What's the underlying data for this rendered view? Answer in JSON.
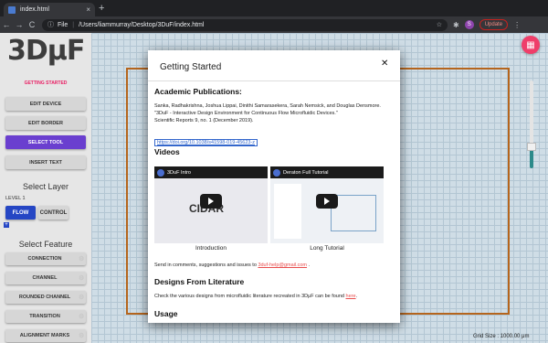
{
  "browser": {
    "tab_title": "index.html",
    "tab_close": "×",
    "new_tab": "+",
    "back": "←",
    "forward": "→",
    "reload": "C",
    "info_label": "File",
    "url": "/Users/liammurray/Desktop/3DuF/index.html",
    "star": "☆",
    "avatar": "S",
    "update_label": "Update",
    "menu": "⋮"
  },
  "sidebar": {
    "logo": "3DμF",
    "getting_started": "GETTING STARTED",
    "tools": [
      "EDIT DEVICE",
      "EDIT BORDER",
      "SELECT TOOL",
      "INSERT TEXT"
    ],
    "select_layer_title": "Select Layer",
    "level_label": "LEVEL 1",
    "flow_label": "FLOW",
    "control_label": "CONTROL",
    "add_layer": "+",
    "select_feature_title": "Select Feature",
    "features": [
      "CONNECTION",
      "CHANNEL",
      "ROUNDED CHANNEL",
      "TRANSITION",
      "ALIGNMENT MARKS"
    ]
  },
  "canvas": {
    "grid_size": "Grid Size : 1000.00 μm",
    "zoom_level": 0.27
  },
  "modal": {
    "title": "Getting Started",
    "close": "✕",
    "pubs_heading": "Academic Publications:",
    "authors": "Sanka, Radhakrishna, Joshua Lippai, Dinithi Samarasekera, Sarah Nemsick, and Douglas Densmore.",
    "paper_title": "\"3DuF - Interactive Design Environment for Continuous Flow Microfluidic Devices.\"",
    "journal": "Scientific Reports 9, no. 1 (December 2019).",
    "doi": "https://doi.org/10.1038/s41598-019-45623-z",
    "videos_heading": "Videos",
    "videos": [
      {
        "title": "3DuF Intro",
        "caption": "Introduction",
        "brand": "CIDAR"
      },
      {
        "title": "Deraton Full Tutorial",
        "caption": "Long Tutorial"
      }
    ],
    "send_prefix": "Send in comments, suggestions and issues to ",
    "email": "3duf-help@gmail.com",
    "send_suffix": " .",
    "designs_heading": "Designs From Literature",
    "designs_text": "Check the various designs from microfluidic literature recreated in 3DμF can be found ",
    "designs_link": "here",
    "designs_suffix": ".",
    "usage_heading": "Usage"
  },
  "colors": {
    "accent_purple": "#6a3fcf",
    "flow_blue": "#2546c4",
    "fab_pink": "#ef3e6a",
    "border_orange": "#b5651d"
  }
}
